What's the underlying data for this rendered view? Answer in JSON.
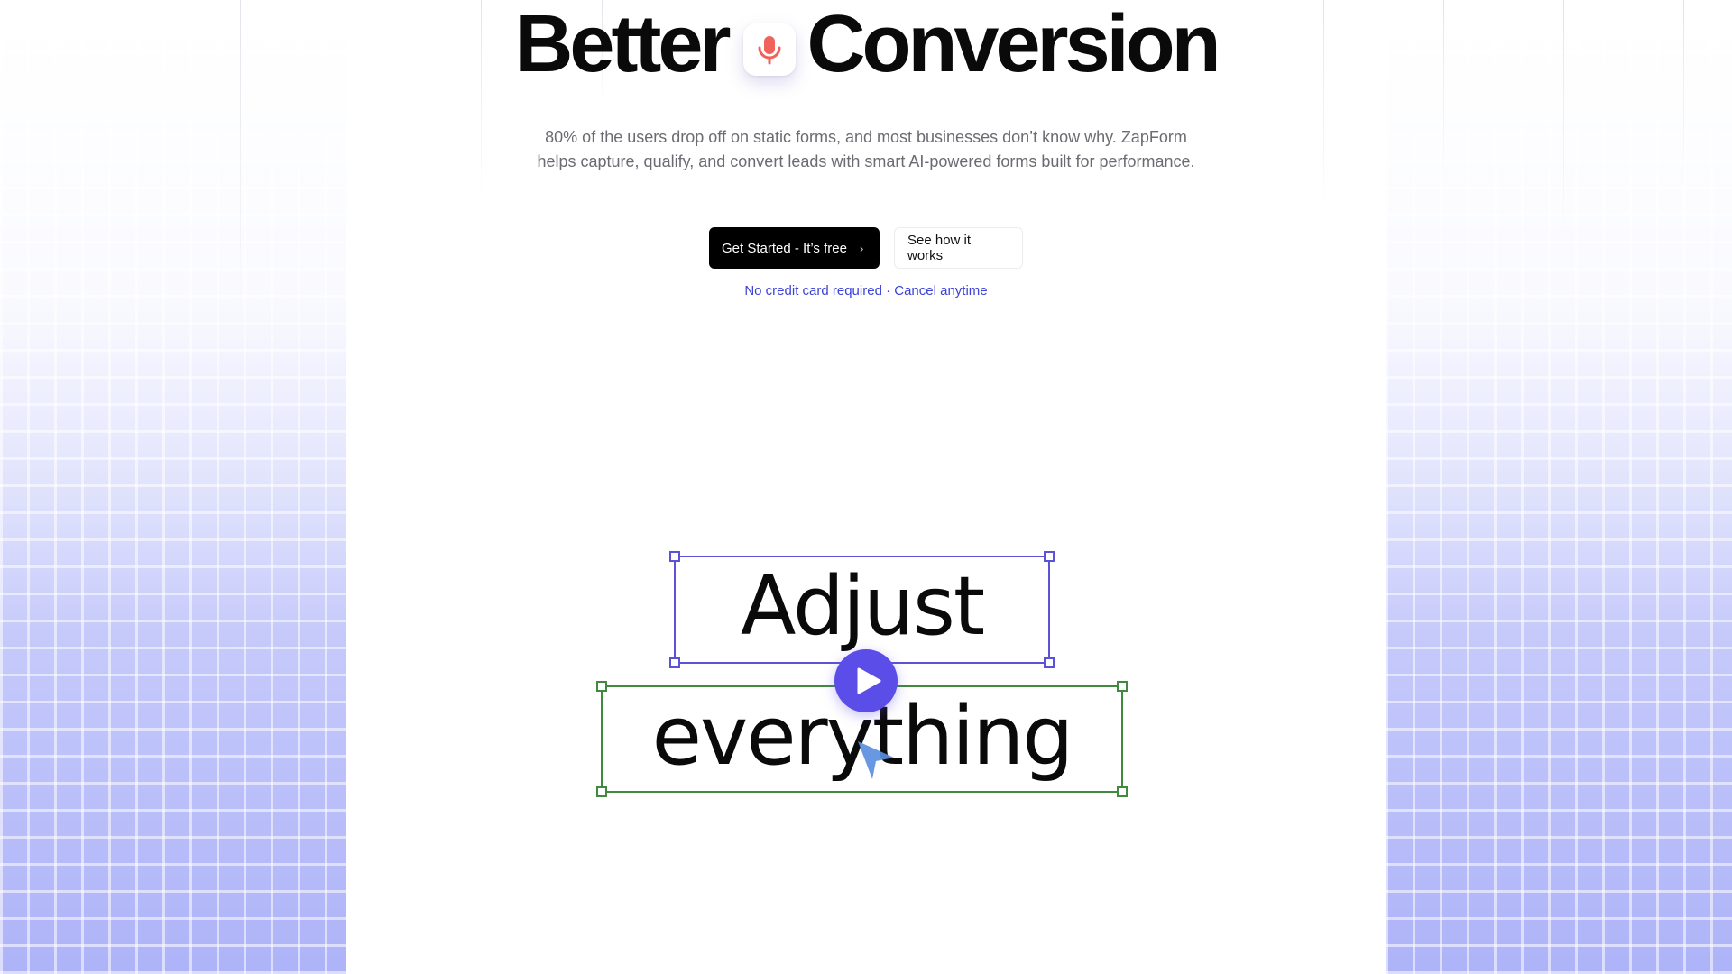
{
  "hero": {
    "title_left": "Better",
    "title_right": "Conversion",
    "icon": "microphone-icon",
    "subtitle": "80% of the users drop off on static forms, and most businesses don’t know why. ZapForm helps capture, qualify, and convert leads with smart AI-powered forms built for performance."
  },
  "cta": {
    "primary_label": "Get Started - It’s free",
    "primary_icon": "chevron-right-icon",
    "secondary_label": "See how it works",
    "note": "No credit card required · Cancel anytime"
  },
  "demo": {
    "line1": "Adjust",
    "line2": "everything",
    "play_icon": "play-icon",
    "cursor_icon": "cursor-arrow-icon"
  },
  "colors": {
    "accent": "#5b4ee8",
    "mic": "#f0625a",
    "note_link": "#3b43d6",
    "box_purple": "#5b52d6",
    "box_green": "#3f8a3f",
    "cursor": "#5b8fe0"
  }
}
